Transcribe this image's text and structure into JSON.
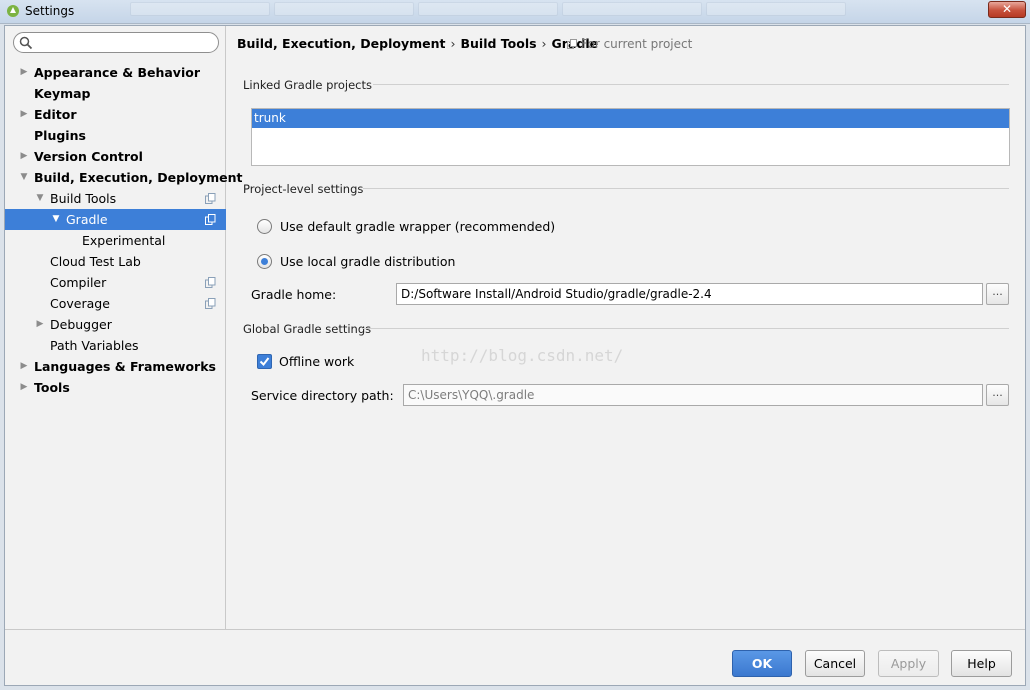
{
  "window": {
    "title": "Settings",
    "close_glyph": "✕"
  },
  "search": {
    "value": "",
    "placeholder": ""
  },
  "sidebar": {
    "items": [
      {
        "label": "Appearance & Behavior",
        "level": 0,
        "bold": true,
        "arrow": "right",
        "copy_icon": false,
        "selected": false
      },
      {
        "label": "Keymap",
        "level": 0,
        "bold": true,
        "arrow": "none",
        "copy_icon": false,
        "selected": false
      },
      {
        "label": "Editor",
        "level": 0,
        "bold": true,
        "arrow": "right",
        "copy_icon": false,
        "selected": false
      },
      {
        "label": "Plugins",
        "level": 0,
        "bold": true,
        "arrow": "none",
        "copy_icon": false,
        "selected": false
      },
      {
        "label": "Version Control",
        "level": 0,
        "bold": true,
        "arrow": "right",
        "copy_icon": false,
        "selected": false
      },
      {
        "label": "Build, Execution, Deployment",
        "level": 0,
        "bold": true,
        "arrow": "down",
        "copy_icon": false,
        "selected": false
      },
      {
        "label": "Build Tools",
        "level": 1,
        "bold": false,
        "arrow": "down",
        "copy_icon": true,
        "selected": false
      },
      {
        "label": "Gradle",
        "level": 2,
        "bold": false,
        "arrow": "down",
        "copy_icon": true,
        "selected": true
      },
      {
        "label": "Experimental",
        "level": 3,
        "bold": false,
        "arrow": "none",
        "copy_icon": false,
        "selected": false
      },
      {
        "label": "Cloud Test Lab",
        "level": 1,
        "bold": false,
        "arrow": "none",
        "copy_icon": false,
        "selected": false
      },
      {
        "label": "Compiler",
        "level": 1,
        "bold": false,
        "arrow": "none",
        "copy_icon": true,
        "selected": false
      },
      {
        "label": "Coverage",
        "level": 1,
        "bold": false,
        "arrow": "none",
        "copy_icon": true,
        "selected": false
      },
      {
        "label": "Debugger",
        "level": 1,
        "bold": false,
        "arrow": "right",
        "copy_icon": false,
        "selected": false
      },
      {
        "label": "Path Variables",
        "level": 1,
        "bold": false,
        "arrow": "none",
        "copy_icon": false,
        "selected": false
      },
      {
        "label": "Languages & Frameworks",
        "level": 0,
        "bold": true,
        "arrow": "right",
        "copy_icon": false,
        "selected": false
      },
      {
        "label": "Tools",
        "level": 0,
        "bold": true,
        "arrow": "right",
        "copy_icon": false,
        "selected": false
      }
    ]
  },
  "breadcrumb": {
    "parts": [
      "Build, Execution, Deployment",
      "Build Tools",
      "Gradle"
    ],
    "separator": "›",
    "note": "For current project"
  },
  "linked_projects": {
    "title": "Linked Gradle projects",
    "items": [
      "trunk"
    ]
  },
  "project_settings": {
    "title": "Project-level settings",
    "option_default": "Use default gradle wrapper (recommended)",
    "option_local": "Use local gradle distribution",
    "selected": "local",
    "gradle_home_label": "Gradle home:",
    "gradle_home_value": "D:/Software Install/Android Studio/gradle/gradle-2.4",
    "browse_label": "..."
  },
  "global_settings": {
    "title": "Global Gradle settings",
    "offline_label": "Offline work",
    "offline_checked": true,
    "service_dir_label": "Service directory path:",
    "service_dir_value": "C:\\Users\\YQQ\\.gradle",
    "browse_label": "..."
  },
  "watermark": "http://blog.csdn.net/",
  "buttons": {
    "ok": "OK",
    "cancel": "Cancel",
    "apply": "Apply",
    "help": "Help"
  },
  "colors": {
    "accent": "#3d7fd8",
    "background": "#f2f2f2"
  }
}
